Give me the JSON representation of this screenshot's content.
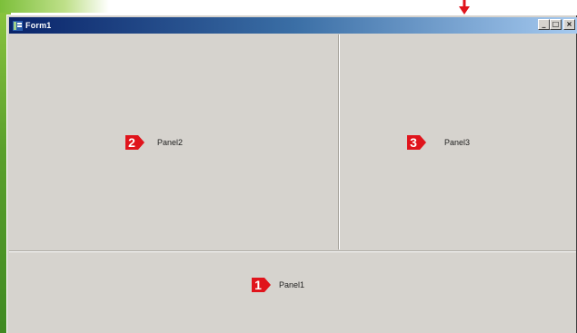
{
  "window": {
    "title": "Form1",
    "controls": {
      "minimize": "_",
      "maximize": "□",
      "close": "×"
    }
  },
  "panels": {
    "panel1": {
      "caption": "Panel1",
      "marker": "1"
    },
    "panel2": {
      "caption": "Panel2",
      "marker": "2"
    },
    "panel3": {
      "caption": "Panel3",
      "marker": "3"
    }
  },
  "colors": {
    "marker_red": "#e0141c",
    "form_gray": "#d6d3ce",
    "title_start": "#0a246a",
    "title_end": "#a6caf0"
  },
  "icons": {
    "app": "delphi-form-icon",
    "pointer": "red-arrow-down-icon"
  }
}
